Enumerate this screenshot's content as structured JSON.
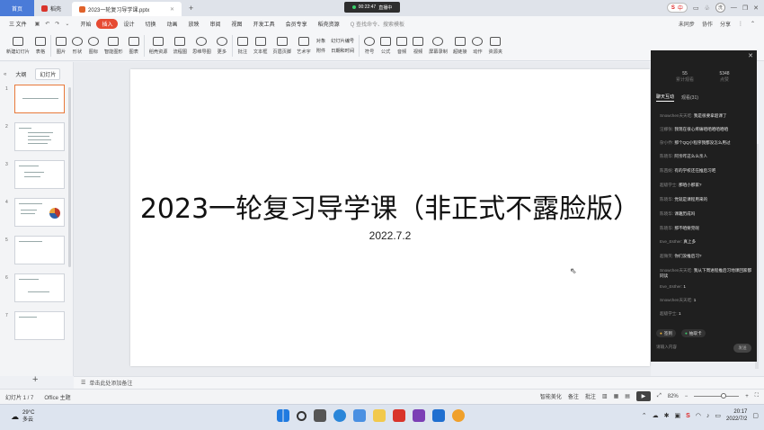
{
  "window": {
    "home_tab": "首页",
    "app_tab": "稻壳",
    "doc_tab": "2023一轮复习导学课.pptx",
    "recording": {
      "time": "00:22:47",
      "label": "直播中"
    },
    "ime": "中",
    "avatar": "洗"
  },
  "menu": {
    "file": "三 文件",
    "items": [
      "开始",
      "插入",
      "设计",
      "切换",
      "动画",
      "放映",
      "审阅",
      "视图",
      "开发工具",
      "会员专享",
      "稻壳资源"
    ],
    "active": "插入",
    "search": "Q 查找命令、搜索模板",
    "right": [
      "未同步",
      "协作",
      "分享"
    ]
  },
  "ribbon": {
    "items": [
      "新建幻灯片",
      "表格",
      "图片",
      "形状",
      "图标",
      "智能图形",
      "图表",
      "稻壳资源",
      "流程图",
      "思维导图",
      "更多",
      "批注",
      "文本框",
      "页眉页脚",
      "艺术字"
    ],
    "stack1": [
      "对象",
      "附件"
    ],
    "stack2": [
      "幻灯片编号",
      "日期和时间"
    ],
    "items2": [
      "符号",
      "公式",
      "音频",
      "视频",
      "屏幕录制",
      "超链接",
      "动作",
      "资源夹"
    ]
  },
  "left_pane": {
    "tabs": [
      "大纲",
      "幻灯片"
    ],
    "active_tab": "幻灯片",
    "slides": [
      1,
      2,
      3,
      4,
      5,
      6,
      7
    ],
    "selected": 1,
    "add": "+"
  },
  "slide": {
    "title": "2023一轮复习导学课（非正式不露脸版）",
    "date": "2022.7.2"
  },
  "notes": {
    "placeholder": "单击此处添加备注"
  },
  "chat": {
    "stats": [
      {
        "value": "55",
        "label": "累计观看"
      },
      {
        "value": "5348",
        "label": "点赞"
      }
    ],
    "tabs": [
      "聊天互动",
      "观看(31)"
    ],
    "active_tab": "聊天互动",
    "messages": [
      {
        "user": "Snowchen天天吃:",
        "text": "我是很要拿超课了"
      },
      {
        "user": "汪娜张:",
        "text": "我现在很心疼痛咱咱咱咱咱咱"
      },
      {
        "user": "杂小乔:",
        "text": "那个QQ小程序我都没怎么用过"
      },
      {
        "user": "陈晓华:",
        "text": "阿亲咋这么么亲人"
      },
      {
        "user": "陈茜妮:",
        "text": "有的学校还在推后习吧"
      },
      {
        "user": "超级学士:",
        "text": "那咱小那家?"
      },
      {
        "user": "陈晓华:",
        "text": "党就是课程用来的"
      },
      {
        "user": "陈晓华:",
        "text": "课趣历成吗"
      },
      {
        "user": "陈晓华:",
        "text": "那不咱要完呢"
      },
      {
        "user": "Eve_Esther:",
        "text": "真上多"
      },
      {
        "user": "超微笑:",
        "text": "你们没推后习?"
      },
      {
        "user": "Snowchen天天吃:",
        "text": "我从下周进程推后习地课回家都同读"
      },
      {
        "user": "Eve_Esther:",
        "text": "1"
      },
      {
        "user": "Snowchen天天吃:",
        "text": "1"
      },
      {
        "user": "超级学士:",
        "text": "1"
      }
    ],
    "buttons": [
      "签到",
      "抽取卡"
    ],
    "input_placeholder": "请输入内容",
    "send": "发送"
  },
  "status": {
    "slide_count": "幻灯片 1 / 7",
    "theme": "Office 主题",
    "right": [
      "智能美化",
      "备注",
      "批注"
    ],
    "zoom": "82%",
    "zoom_level": 0.6
  },
  "taskbar": {
    "temp": "29°C",
    "weather": "多云",
    "time": "20:17",
    "date": "2022/7/2"
  },
  "colors": {
    "accent": "#e64a32",
    "home_blue": "#4a7bd8",
    "selected_thumb": "#e8793a"
  }
}
